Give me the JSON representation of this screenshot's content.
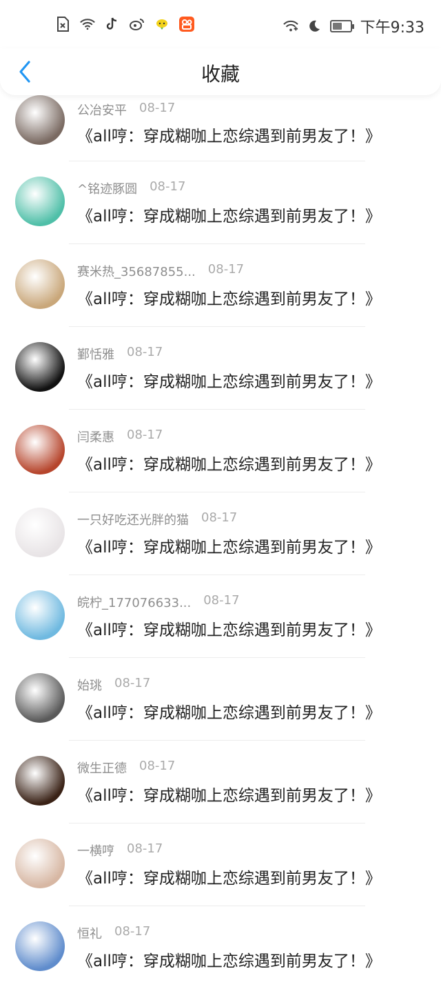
{
  "status_bar": {
    "left_icons": [
      "sim-off-icon",
      "wifi-icon",
      "tiktok-icon",
      "weibo-icon",
      "chat-bubble-icon",
      "kuaishou-icon"
    ],
    "right_icons": [
      "wifi-plus-icon",
      "moon-icon",
      "battery-icon"
    ],
    "time": "下午9:33",
    "battery_level": 0.55
  },
  "header": {
    "title": "收藏",
    "back_icon": "chevron-left-icon",
    "accent_color": "#2196F3"
  },
  "items": [
    {
      "name": "公冶安平",
      "date": "08-17",
      "text": "《all哼：穿成糊咖上恋综遇到前男友了！》",
      "avatar_color": "#7a6a62"
    },
    {
      "name": "^铭迹豚圆",
      "date": "08-17",
      "text": "《all哼：穿成糊咖上恋综遇到前男友了！》",
      "avatar_color": "#4fbfa8"
    },
    {
      "name": "赛米热_35687855...",
      "date": "08-17",
      "text": "《all哼：穿成糊咖上恋综遇到前男友了！》",
      "avatar_color": "#c9a77a"
    },
    {
      "name": "鄞恬雅",
      "date": "08-17",
      "text": "《all哼：穿成糊咖上恋综遇到前男友了！》",
      "avatar_color": "#111111"
    },
    {
      "name": "闫柔惠",
      "date": "08-17",
      "text": "《all哼：穿成糊咖上恋综遇到前男友了！》",
      "avatar_color": "#b6452c"
    },
    {
      "name": "一只好吃还光胖的猫",
      "date": "08-17",
      "text": "《all哼：穿成糊咖上恋综遇到前男友了！》",
      "avatar_color": "#e8e4e6"
    },
    {
      "name": "皖柠_177076633...",
      "date": "08-17",
      "text": "《all哼：穿成糊咖上恋综遇到前男友了！》",
      "avatar_color": "#6fb9e0"
    },
    {
      "name": "始珧",
      "date": "08-17",
      "text": "《all哼：穿成糊咖上恋综遇到前男友了！》",
      "avatar_color": "#5a5a5a"
    },
    {
      "name": "微生正德",
      "date": "08-17",
      "text": "《all哼：穿成糊咖上恋综遇到前男友了！》",
      "avatar_color": "#3a2216"
    },
    {
      "name": "一横哼",
      "date": "08-17",
      "text": "《all哼：穿成糊咖上恋综遇到前男友了！》",
      "avatar_color": "#d7b7a3"
    },
    {
      "name": "恒礼",
      "date": "08-17",
      "text": "《all哼：穿成糊咖上恋综遇到前男友了！》",
      "avatar_color": "#5f8ccc"
    }
  ]
}
